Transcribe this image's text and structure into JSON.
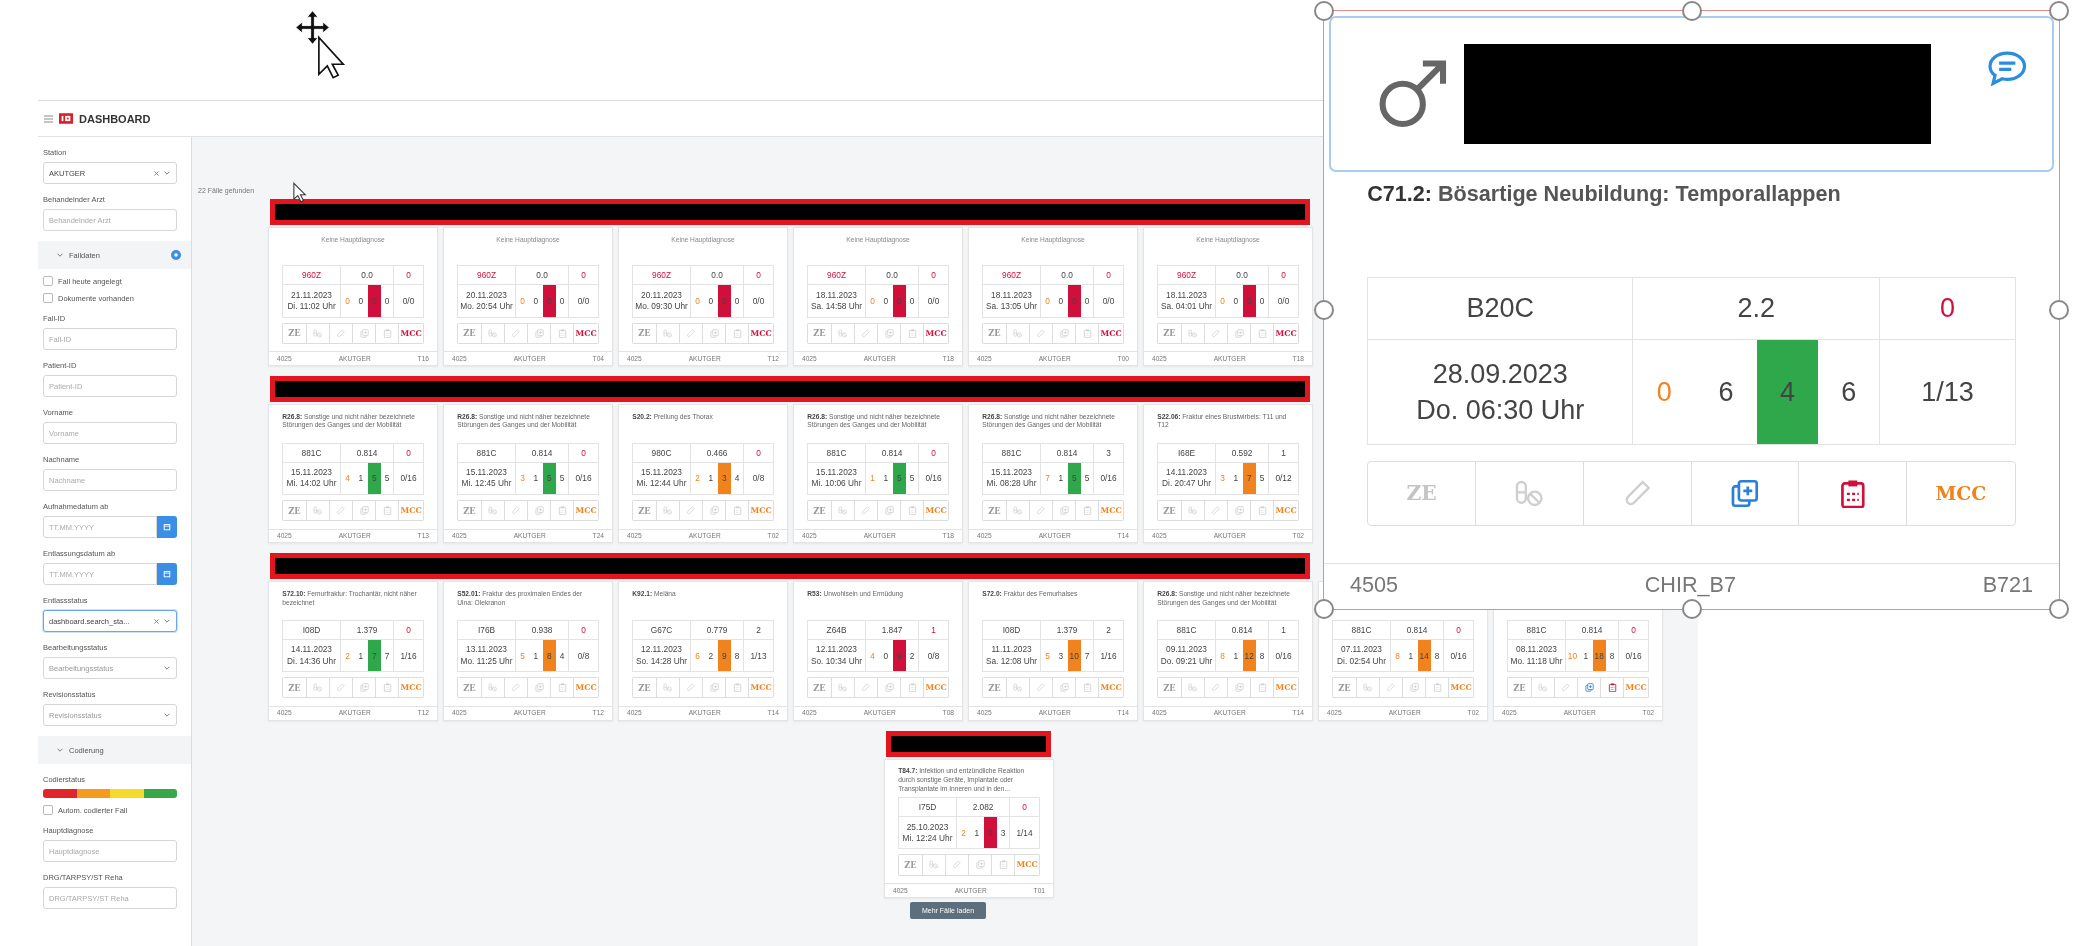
{
  "header": {
    "title": "DASHBOARD"
  },
  "sidebar": {
    "items": [
      {
        "kind": "select",
        "label": "Station",
        "value": "AKUTGER",
        "clearable": true,
        "focused": false
      },
      {
        "kind": "input",
        "label": "Behandelnder Arzt",
        "placeholder": "Behandelnder Arzt"
      },
      {
        "kind": "section",
        "label": "Falldaten",
        "expanded": true,
        "badge": true
      },
      {
        "kind": "checkbox",
        "label": "Fall heute angelegt",
        "checked": false
      },
      {
        "kind": "checkbox",
        "label": "Dokumente vorhanden",
        "checked": false
      },
      {
        "kind": "input",
        "label": "Fall-ID",
        "placeholder": "Fall-ID"
      },
      {
        "kind": "input",
        "label": "Patient-ID",
        "placeholder": "Patient-ID"
      },
      {
        "kind": "input",
        "label": "Vorname",
        "placeholder": "Vorname"
      },
      {
        "kind": "input",
        "label": "Nachname",
        "placeholder": "Nachname"
      },
      {
        "kind": "date",
        "label": "Aufnahmedatum ab",
        "placeholder": "TT.MM.YYYY"
      },
      {
        "kind": "date",
        "label": "Entlassungsdatum ab",
        "placeholder": "TT.MM.YYYY"
      },
      {
        "kind": "select",
        "label": "Entlassstatus",
        "value": "dashboard.search_sta...",
        "clearable": true,
        "focused": true
      },
      {
        "kind": "select",
        "label": "Bearbeitungsstatus",
        "placeholder": "Bearbeitungsstatus",
        "clearable": false,
        "focused": false
      },
      {
        "kind": "select",
        "label": "Revisionsstatus",
        "placeholder": "Revisionsstatus",
        "clearable": false,
        "focused": false
      },
      {
        "kind": "section",
        "label": "Codierung",
        "expanded": true,
        "badge": false
      },
      {
        "kind": "colorbar",
        "label": "Codierstatus",
        "segments": [
          {
            "color": "#e0262b"
          },
          {
            "color": "#f39c1f"
          },
          {
            "color": "#f5dc2c"
          },
          {
            "color": "#3aa64a"
          }
        ]
      },
      {
        "kind": "checkbox",
        "label": "Autom. codierter Fall",
        "checked": false
      },
      {
        "kind": "input",
        "label": "Hauptdiagnose",
        "placeholder": "Hauptdiagnose"
      },
      {
        "kind": "input",
        "label": "DRG/TARPSY/ST Reha",
        "placeholder": "DRG/TARPSY/ST Reha"
      }
    ]
  },
  "results": {
    "count_text": "22 Fälle gefunden",
    "load_more": "Mehr Fälle laden"
  },
  "card_rows": [
    {
      "cards": [
        {
          "kind": "none",
          "diagnosis": "Keine Hauptdiagnose",
          "drg": "960Z",
          "drg_alert": true,
          "cw": "0.0",
          "flag": "0",
          "flag_alert": true,
          "date": "21.11.2023",
          "time": "Di. 11:02 Uhr",
          "days": [
            "0",
            "0",
            "0",
            "0"
          ],
          "color": "#d0103a",
          "ratio": "0/0",
          "ze": "ZE",
          "mcc": "MCC",
          "mcc_alert": true,
          "copy_on": false,
          "clip_on": false,
          "id": "4025",
          "ward": "AKUTGER",
          "bed": "T16"
        },
        {
          "kind": "none",
          "diagnosis": "Keine Hauptdiagnose",
          "drg": "960Z",
          "drg_alert": true,
          "cw": "0.0",
          "flag": "0",
          "flag_alert": true,
          "date": "20.11.2023",
          "time": "Mo. 20:54 Uhr",
          "days": [
            "0",
            "0",
            "0",
            "0"
          ],
          "color": "#d0103a",
          "ratio": "0/0",
          "ze": "ZE",
          "mcc": "MCC",
          "mcc_alert": true,
          "copy_on": false,
          "clip_on": false,
          "id": "4025",
          "ward": "AKUTGER",
          "bed": "T04"
        },
        {
          "kind": "none",
          "diagnosis": "Keine Hauptdiagnose",
          "drg": "960Z",
          "drg_alert": true,
          "cw": "0.0",
          "flag": "0",
          "flag_alert": true,
          "date": "20.11.2023",
          "time": "Mo. 09:30 Uhr",
          "days": [
            "0",
            "0",
            "0",
            "0"
          ],
          "color": "#d0103a",
          "ratio": "0/0",
          "ze": "ZE",
          "mcc": "MCC",
          "mcc_alert": true,
          "copy_on": false,
          "clip_on": false,
          "id": "4025",
          "ward": "AKUTGER",
          "bed": "T12"
        },
        {
          "kind": "none",
          "diagnosis": "Keine Hauptdiagnose",
          "drg": "960Z",
          "drg_alert": true,
          "cw": "0.0",
          "flag": "0",
          "flag_alert": true,
          "date": "18.11.2023",
          "time": "Sa. 14:58 Uhr",
          "days": [
            "0",
            "0",
            "0",
            "0"
          ],
          "color": "#d0103a",
          "ratio": "0/0",
          "ze": "ZE",
          "mcc": "MCC",
          "mcc_alert": true,
          "copy_on": false,
          "clip_on": false,
          "id": "4025",
          "ward": "AKUTGER",
          "bed": "T18"
        },
        {
          "kind": "none",
          "diagnosis": "Keine Hauptdiagnose",
          "drg": "960Z",
          "drg_alert": true,
          "cw": "0.0",
          "flag": "0",
          "flag_alert": true,
          "date": "18.11.2023",
          "time": "Sa. 13:05 Uhr",
          "days": [
            "0",
            "0",
            "0",
            "0"
          ],
          "color": "#d0103a",
          "ratio": "0/0",
          "ze": "ZE",
          "mcc": "MCC",
          "mcc_alert": true,
          "copy_on": false,
          "clip_on": false,
          "id": "4025",
          "ward": "AKUTGER",
          "bed": "T00"
        },
        {
          "kind": "none",
          "diagnosis": "Keine Hauptdiagnose",
          "drg": "960Z",
          "drg_alert": true,
          "cw": "0.0",
          "flag": "0",
          "flag_alert": true,
          "date": "18.11.2023",
          "time": "Sa. 04:01 Uhr",
          "days": [
            "0",
            "0",
            "0",
            "0"
          ],
          "color": "#d0103a",
          "ratio": "0/0",
          "ze": "ZE",
          "mcc": "MCC",
          "mcc_alert": true,
          "copy_on": false,
          "clip_on": false,
          "id": "4025",
          "ward": "AKUTGER",
          "bed": "T18"
        }
      ]
    },
    {
      "cards": [
        {
          "kind": "coded",
          "diagnosis": "**R26.8:** Sonstige und nicht näher bezeichnete Störungen des Ganges und der Mobilität",
          "drg": "881C",
          "drg_alert": false,
          "cw": "0.814",
          "flag": "0",
          "flag_alert": true,
          "date": "15.11.2023",
          "time": "Mi. 14:02 Uhr",
          "days": [
            "4",
            "1",
            "5",
            "5"
          ],
          "color": "#2ea84a",
          "ratio": "0/16",
          "ze": "ZE",
          "mcc": "MCC",
          "mcc_alert": false,
          "copy_on": false,
          "clip_on": false,
          "id": "4025",
          "ward": "AKUTGER",
          "bed": "T13"
        },
        {
          "kind": "coded",
          "diagnosis": "**R26.8:** Sonstige und nicht näher bezeichnete Störungen des Ganges und der Mobilität",
          "drg": "881C",
          "drg_alert": false,
          "cw": "0.814",
          "flag": "0",
          "flag_alert": true,
          "date": "15.11.2023",
          "time": "Mi. 12:45 Uhr",
          "days": [
            "3",
            "1",
            "5",
            "5"
          ],
          "color": "#2ea84a",
          "ratio": "0/16",
          "ze": "ZE",
          "mcc": "MCC",
          "mcc_alert": false,
          "copy_on": false,
          "clip_on": false,
          "id": "4025",
          "ward": "AKUTGER",
          "bed": "T24"
        },
        {
          "kind": "coded",
          "diagnosis": "**S20.2:** Prellung des Thorax",
          "drg": "980C",
          "drg_alert": false,
          "cw": "0.466",
          "flag": "0",
          "flag_alert": true,
          "date": "15.11.2023",
          "time": "Mi. 12:44 Uhr",
          "days": [
            "2",
            "1",
            "3",
            "4"
          ],
          "color": "#f0831e",
          "ratio": "0/8",
          "ze": "ZE",
          "mcc": "MCC",
          "mcc_alert": false,
          "copy_on": false,
          "clip_on": false,
          "id": "4025",
          "ward": "AKUTGER",
          "bed": "T02"
        },
        {
          "kind": "coded",
          "diagnosis": "**R26.8:** Sonstige und nicht näher bezeichnete Störungen des Ganges und der Mobilität",
          "drg": "881C",
          "drg_alert": false,
          "cw": "0.814",
          "flag": "0",
          "flag_alert": true,
          "date": "15.11.2023",
          "time": "Mi. 10:06 Uhr",
          "days": [
            "1",
            "1",
            "5",
            "5"
          ],
          "color": "#2ea84a",
          "ratio": "0/16",
          "ze": "ZE",
          "mcc": "MCC",
          "mcc_alert": false,
          "copy_on": false,
          "clip_on": false,
          "id": "4025",
          "ward": "AKUTGER",
          "bed": "T18"
        },
        {
          "kind": "coded",
          "diagnosis": "**R26.8:** Sonstige und nicht näher bezeichnete Störungen des Ganges und der Mobilität",
          "drg": "881C",
          "drg_alert": false,
          "cw": "0.814",
          "flag": "3",
          "flag_alert": false,
          "date": "15.11.2023",
          "time": "Mi. 08:28 Uhr",
          "days": [
            "7",
            "1",
            "5",
            "5"
          ],
          "color": "#2ea84a",
          "ratio": "0/16",
          "ze": "ZE",
          "mcc": "MCC",
          "mcc_alert": false,
          "copy_on": false,
          "clip_on": false,
          "id": "4025",
          "ward": "AKUTGER",
          "bed": "T14"
        },
        {
          "kind": "coded",
          "diagnosis": "**S22.06:** Fraktur eines Brustwirbels: T11 und T12",
          "drg": "I68E",
          "drg_alert": false,
          "cw": "0.592",
          "flag": "1",
          "flag_alert": false,
          "date": "14.11.2023",
          "time": "Di. 20:47 Uhr",
          "days": [
            "3",
            "1",
            "7",
            "5"
          ],
          "color": "#f0831e",
          "ratio": "0/12",
          "ze": "ZE",
          "mcc": "MCC",
          "mcc_alert": false,
          "copy_on": false,
          "clip_on": false,
          "id": "4025",
          "ward": "AKUTGER",
          "bed": "T02"
        }
      ]
    },
    {
      "cards": [
        {
          "kind": "coded",
          "diagnosis": "**S72.10:** Femurfraktur: Trochantär, nicht näher bezeichnet",
          "drg": "I08D",
          "drg_alert": false,
          "cw": "1.379",
          "flag": "0",
          "flag_alert": true,
          "date": "14.11.2023",
          "time": "Di. 14:36 Uhr",
          "days": [
            "2",
            "1",
            "7",
            "7"
          ],
          "color": "#2ea84a",
          "ratio": "1/16",
          "ze": "ZE",
          "mcc": "MCC",
          "mcc_alert": false,
          "copy_on": false,
          "clip_on": false,
          "id": "4025",
          "ward": "AKUTGER",
          "bed": "T12"
        },
        {
          "kind": "coded",
          "diagnosis": "**S52.01:** Fraktur des proximalen Endes der Ulna: Olekranon",
          "drg": "I76B",
          "drg_alert": false,
          "cw": "0.938",
          "flag": "0",
          "flag_alert": true,
          "date": "13.11.2023",
          "time": "Mo. 11:25 Uhr",
          "days": [
            "5",
            "1",
            "8",
            "4"
          ],
          "color": "#f0831e",
          "ratio": "0/8",
          "ze": "ZE",
          "mcc": "MCC",
          "mcc_alert": false,
          "copy_on": false,
          "clip_on": false,
          "id": "4025",
          "ward": "AKUTGER",
          "bed": "T12"
        },
        {
          "kind": "coded",
          "diagnosis": "**K92.1:** Meläna",
          "drg": "G67C",
          "drg_alert": false,
          "cw": "0.779",
          "flag": "2",
          "flag_alert": false,
          "date": "12.11.2023",
          "time": "So. 14:28 Uhr",
          "days": [
            "6",
            "2",
            "9",
            "8"
          ],
          "color": "#f0831e",
          "ratio": "1/13",
          "ze": "ZE",
          "mcc": "MCC",
          "mcc_alert": false,
          "copy_on": false,
          "clip_on": false,
          "id": "4025",
          "ward": "AKUTGER",
          "bed": "T14"
        },
        {
          "kind": "coded",
          "diagnosis": "**R53:** Unwohlsein und Ermüdung",
          "drg": "Z64B",
          "drg_alert": false,
          "cw": "1.847",
          "flag": "1",
          "flag_alert": true,
          "date": "12.11.2023",
          "time": "So. 10:34 Uhr",
          "days": [
            "4",
            "0",
            "9",
            "2"
          ],
          "color": "#d0103a",
          "ratio": "0/8",
          "ze": "ZE",
          "mcc": "MCC",
          "mcc_alert": false,
          "copy_on": false,
          "clip_on": false,
          "id": "4025",
          "ward": "AKUTGER",
          "bed": "T08"
        },
        {
          "kind": "coded",
          "diagnosis": "**S72.0:** Fraktur des Femurhalses",
          "drg": "I08D",
          "drg_alert": false,
          "cw": "1.379",
          "flag": "2",
          "flag_alert": false,
          "date": "11.11.2023",
          "time": "Sa. 12:08 Uhr",
          "days": [
            "5",
            "3",
            "10",
            "7"
          ],
          "color": "#f0831e",
          "ratio": "1/16",
          "ze": "ZE",
          "mcc": "MCC",
          "mcc_alert": false,
          "copy_on": false,
          "clip_on": false,
          "id": "4025",
          "ward": "AKUTGER",
          "bed": "T14"
        },
        {
          "kind": "coded",
          "diagnosis": "**R26.8:** Sonstige und nicht näher bezeichnete Störungen des Ganges und der Mobilität",
          "drg": "881C",
          "drg_alert": false,
          "cw": "0.814",
          "flag": "1",
          "flag_alert": false,
          "date": "09.11.2023",
          "time": "Do. 09:21 Uhr",
          "days": [
            "8",
            "1",
            "12",
            "8"
          ],
          "color": "#f0831e",
          "ratio": "0/16",
          "ze": "ZE",
          "mcc": "MCC",
          "mcc_alert": false,
          "copy_on": false,
          "clip_on": false,
          "id": "4025",
          "ward": "AKUTGER",
          "bed": "T14"
        },
        {
          "kind": "covered",
          "drg": "881C",
          "drg_alert": false,
          "cw": "0.814",
          "flag": "0",
          "flag_alert": true,
          "date": "07.11.2023",
          "time": "Di. 02:54 Uhr",
          "days": [
            "8",
            "1",
            "14",
            "8"
          ],
          "color": "#f0831e",
          "ratio": "0/16",
          "ze": "ZE",
          "mcc": "MCC",
          "mcc_alert": false,
          "copy_on": false,
          "clip_on": false,
          "id": "4025",
          "ward": "AKUTGER",
          "bed": "T02"
        },
        {
          "kind": "covered",
          "drg": "881C",
          "drg_alert": false,
          "cw": "0.814",
          "flag": "0",
          "flag_alert": true,
          "date": "08.11.2023",
          "time": "Mo. 11:18 Uhr",
          "days": [
            "10",
            "1",
            "18",
            "8"
          ],
          "color": "#f0831e",
          "ratio": "0/16",
          "ze": "ZE",
          "mcc": "MCC",
          "mcc_alert": false,
          "copy_on": true,
          "clip_on": true,
          "id": "4025",
          "ward": "AKUTGER",
          "bed": "T02"
        }
      ]
    },
    {
      "cards": [
        {
          "kind": "coded",
          "diagnosis": "**T84.7:** Infektion und entzündliche Reaktion durch sonstige Geräte, Implantate oder Transplantate im Inneren und in den...",
          "drg": "I75D",
          "drg_alert": false,
          "cw": "2.082",
          "flag": "0",
          "flag_alert": true,
          "date": "25.10.2023",
          "time": "Mi. 12:24 Uhr",
          "days": [
            "2",
            "1",
            "9",
            "3"
          ],
          "color": "#d0103a",
          "ratio": "1/14",
          "ze": "ZE",
          "mcc": "MCC",
          "mcc_alert": false,
          "copy_on": false,
          "clip_on": false,
          "id": "4025",
          "ward": "AKUTGER",
          "bed": "T01"
        }
      ]
    }
  ],
  "detail_card": {
    "male": true,
    "kind": "coded",
    "diagnosis": "**C71.2:** Bösartige Neubildung: Temporallappen",
    "drg": "B20C",
    "drg_alert": false,
    "cw": "2.2",
    "flag": "0",
    "flag_alert": true,
    "date": "28.09.2023",
    "time": "Do. 06:30 Uhr",
    "days": [
      "0",
      "6",
      "4",
      "6"
    ],
    "color": "#2ea84a",
    "ratio": "1/13",
    "ze": "ZE",
    "mcc": "MCC",
    "mcc_alert": false,
    "copy_on": true,
    "clip_on": true,
    "id": "4505",
    "ward": "CHIR_B7",
    "bed": "B721"
  }
}
